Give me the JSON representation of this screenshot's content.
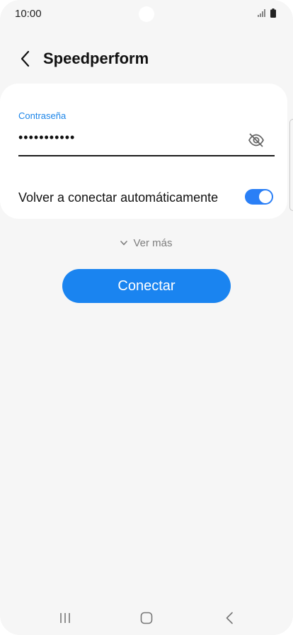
{
  "status_bar": {
    "time": "10:00"
  },
  "header": {
    "title": "Speedperform"
  },
  "password": {
    "label": "Contraseña",
    "value": "•••••••••••"
  },
  "auto_reconnect": {
    "label": "Volver a conectar automáticamente",
    "enabled": true
  },
  "more": {
    "label": "Ver más"
  },
  "connect_button": {
    "label": "Conectar"
  },
  "colors": {
    "accent": "#1a84f0",
    "label_blue": "#1a84e8",
    "toggle_on": "#2a7ff6",
    "background": "#f6f6f6"
  },
  "icons": {
    "back": "chevron-left-icon",
    "eye": "eye-off-icon",
    "expand": "chevron-down-icon",
    "nav_recents": "recent-apps-icon",
    "nav_home": "home-icon",
    "nav_back": "nav-back-icon"
  }
}
